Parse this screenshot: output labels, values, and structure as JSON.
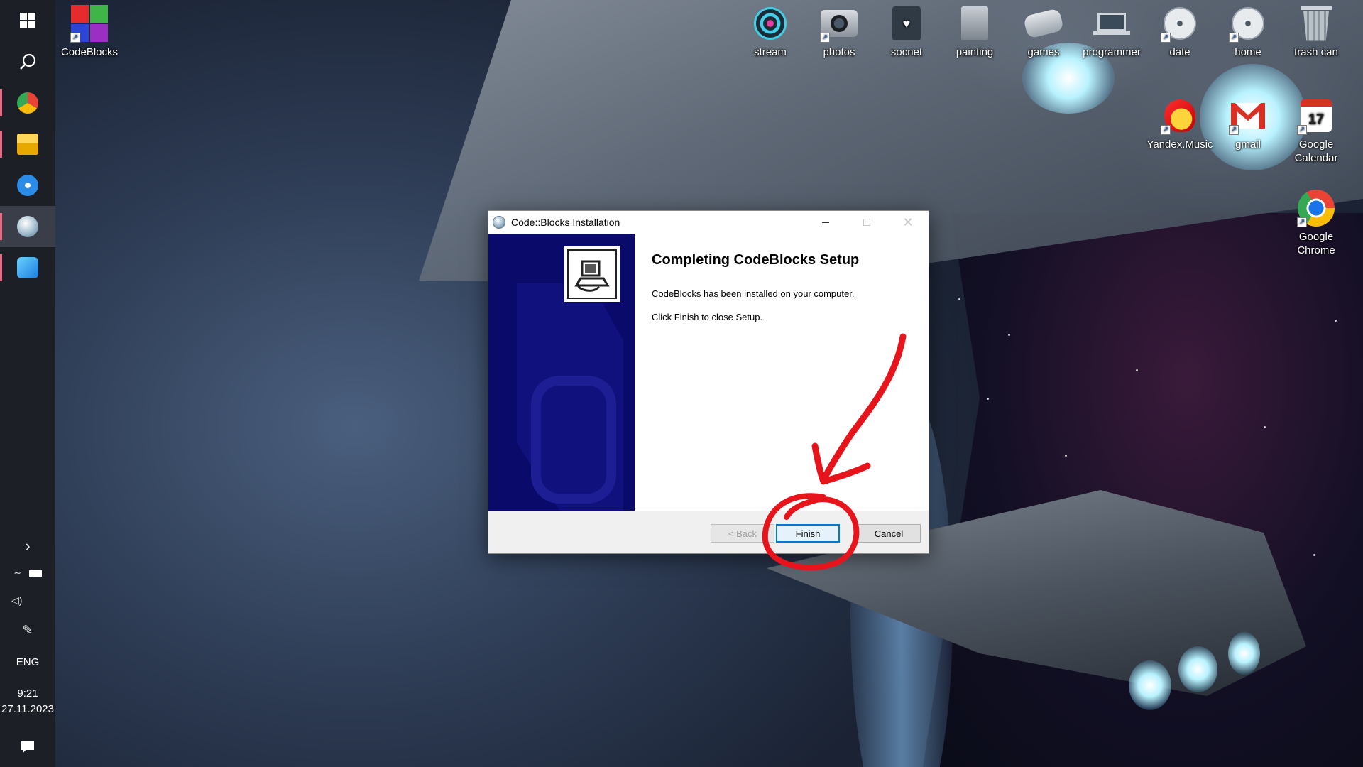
{
  "taskbar": {
    "pinned_apps": [
      {
        "name": "windows-logo-icon"
      },
      {
        "name": "search-icon"
      },
      {
        "name": "chrome-profile-icon"
      },
      {
        "name": "file-explorer-icon"
      },
      {
        "name": "media-app-icon"
      },
      {
        "name": "installer-app-icon"
      },
      {
        "name": "photos-app-icon"
      }
    ],
    "language": "ENG",
    "time": "9:21",
    "date": "27.11.2023"
  },
  "desktop_icons": [
    {
      "label": "CodeBlocks",
      "icon": "codeblocks-icon"
    },
    {
      "label": "stream",
      "icon": "stream-icon"
    },
    {
      "label": "photos",
      "icon": "camera-icon"
    },
    {
      "label": "socnet",
      "icon": "socnet-icon"
    },
    {
      "label": "painting",
      "icon": "painting-icon"
    },
    {
      "label": "games",
      "icon": "gamepad-icon"
    },
    {
      "label": "programmer",
      "icon": "laptop-icon"
    },
    {
      "label": "date",
      "icon": "disc-icon"
    },
    {
      "label": "home",
      "icon": "disc-icon"
    },
    {
      "label": "trash can",
      "icon": "trash-icon"
    },
    {
      "label": "Yandex.Music",
      "icon": "guitar-icon"
    },
    {
      "label": "gmail",
      "icon": "gmail-icon"
    },
    {
      "label": "Google Calendar",
      "icon": "calendar-icon",
      "calendar_day": "17"
    },
    {
      "label": "Google Chrome",
      "icon": "chrome-icon"
    }
  ],
  "dialog": {
    "title": "Code::Blocks Installation",
    "heading": "Completing CodeBlocks Setup",
    "line1": "CodeBlocks has been installed on your computer.",
    "line2": "Click Finish to close Setup.",
    "buttons": {
      "back": "< Back",
      "finish": "Finish",
      "cancel": "Cancel"
    }
  },
  "colors": {
    "annotation": "#e8141c",
    "taskbar_bg": "#1c1f26",
    "installer_banner": "#0a0a6a"
  }
}
